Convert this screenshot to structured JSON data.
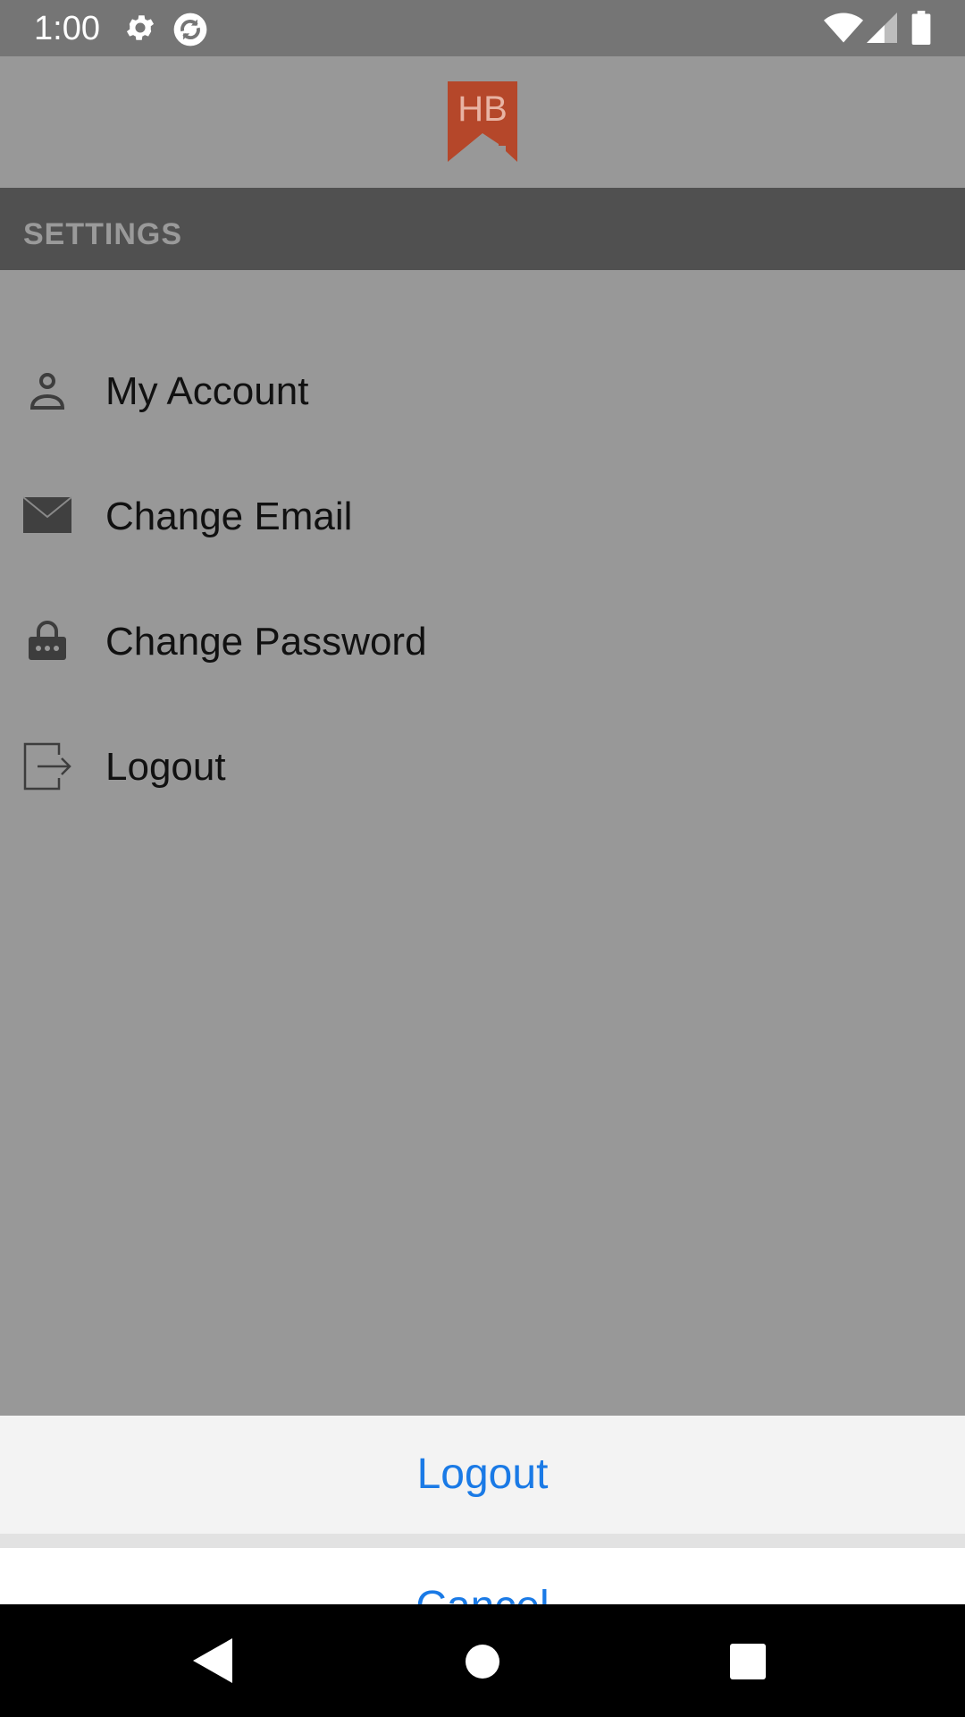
{
  "status_bar": {
    "time": "1:00",
    "icons": [
      "settings-gear-icon",
      "sync-icon",
      "wifi-icon",
      "signal-icon",
      "battery-icon"
    ]
  },
  "app_header": {
    "logo_text": "HB",
    "logo_color": "#b5472a"
  },
  "section": {
    "title": "SETTINGS"
  },
  "menu": {
    "items": [
      {
        "label": "My Account",
        "icon": "person-icon"
      },
      {
        "label": "Change Email",
        "icon": "envelope-icon"
      },
      {
        "label": "Change Password",
        "icon": "lock-icon"
      },
      {
        "label": "Logout",
        "icon": "logout-icon"
      }
    ]
  },
  "action_sheet": {
    "primary_label": "Logout",
    "cancel_label": "Cancel",
    "label_color": "#1a7ae6"
  },
  "nav_bar": {
    "icons": [
      "back-icon",
      "home-icon",
      "recents-icon"
    ]
  }
}
